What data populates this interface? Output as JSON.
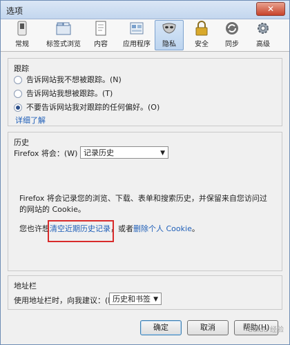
{
  "window": {
    "title": "选项",
    "close_glyph": "✕"
  },
  "toolbar": {
    "items": [
      {
        "label": "常规",
        "icon": "switch-icon"
      },
      {
        "label": "标签式浏览",
        "icon": "tabs-icon"
      },
      {
        "label": "内容",
        "icon": "page-icon"
      },
      {
        "label": "应用程序",
        "icon": "apps-icon"
      },
      {
        "label": "隐私",
        "icon": "mask-icon",
        "active": true
      },
      {
        "label": "安全",
        "icon": "lock-icon"
      },
      {
        "label": "同步",
        "icon": "sync-icon"
      },
      {
        "label": "高级",
        "icon": "gear-icon"
      }
    ]
  },
  "tracking": {
    "title": "跟踪",
    "options": [
      {
        "label": "告诉网站我不想被跟踪。(N)",
        "checked": false
      },
      {
        "label": "告诉网站我想被跟踪。(T)",
        "checked": false
      },
      {
        "label": "不要告诉网站我对跟踪的任何偏好。(O)",
        "checked": true
      }
    ],
    "learn_more": "详细了解"
  },
  "history": {
    "title": "历史",
    "prefix": "Firefox 将会：(W)",
    "select_value": "记录历史",
    "desc": "Firefox 将会记录您的浏览、下载、表单和搜索历史，并保留来自您访问过的网站的 Cookie。",
    "also_prefix": "您也许想",
    "clear_link": "清空近期历史记录",
    "middle": "，或者",
    "remove_link": "删除个人 Cookie",
    "end": "。"
  },
  "address": {
    "title": "地址栏",
    "label": "使用地址栏时，向我建议：(L)",
    "select_value": "历史和书签"
  },
  "buttons": {
    "ok": "确定",
    "cancel": "取消",
    "help": "帮助(H)"
  },
  "watermark": "Baidu 经验"
}
